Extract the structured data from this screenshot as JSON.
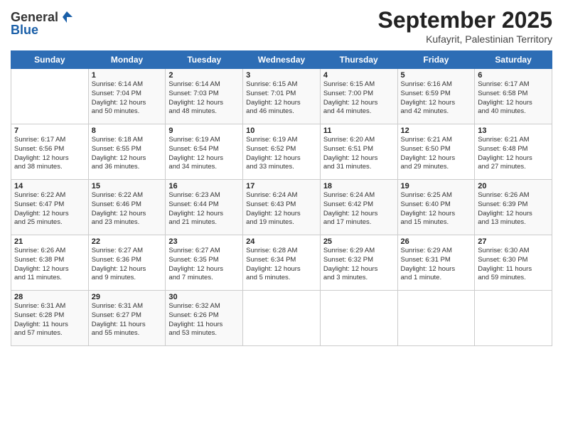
{
  "header": {
    "logo_line1": "General",
    "logo_line2": "Blue",
    "main_title": "September 2025",
    "subtitle": "Kufayrit, Palestinian Territory"
  },
  "calendar": {
    "days_of_week": [
      "Sunday",
      "Monday",
      "Tuesday",
      "Wednesday",
      "Thursday",
      "Friday",
      "Saturday"
    ],
    "weeks": [
      [
        {
          "num": "",
          "info": ""
        },
        {
          "num": "1",
          "info": "Sunrise: 6:14 AM\nSunset: 7:04 PM\nDaylight: 12 hours\nand 50 minutes."
        },
        {
          "num": "2",
          "info": "Sunrise: 6:14 AM\nSunset: 7:03 PM\nDaylight: 12 hours\nand 48 minutes."
        },
        {
          "num": "3",
          "info": "Sunrise: 6:15 AM\nSunset: 7:01 PM\nDaylight: 12 hours\nand 46 minutes."
        },
        {
          "num": "4",
          "info": "Sunrise: 6:15 AM\nSunset: 7:00 PM\nDaylight: 12 hours\nand 44 minutes."
        },
        {
          "num": "5",
          "info": "Sunrise: 6:16 AM\nSunset: 6:59 PM\nDaylight: 12 hours\nand 42 minutes."
        },
        {
          "num": "6",
          "info": "Sunrise: 6:17 AM\nSunset: 6:58 PM\nDaylight: 12 hours\nand 40 minutes."
        }
      ],
      [
        {
          "num": "7",
          "info": "Sunrise: 6:17 AM\nSunset: 6:56 PM\nDaylight: 12 hours\nand 38 minutes."
        },
        {
          "num": "8",
          "info": "Sunrise: 6:18 AM\nSunset: 6:55 PM\nDaylight: 12 hours\nand 36 minutes."
        },
        {
          "num": "9",
          "info": "Sunrise: 6:19 AM\nSunset: 6:54 PM\nDaylight: 12 hours\nand 34 minutes."
        },
        {
          "num": "10",
          "info": "Sunrise: 6:19 AM\nSunset: 6:52 PM\nDaylight: 12 hours\nand 33 minutes."
        },
        {
          "num": "11",
          "info": "Sunrise: 6:20 AM\nSunset: 6:51 PM\nDaylight: 12 hours\nand 31 minutes."
        },
        {
          "num": "12",
          "info": "Sunrise: 6:21 AM\nSunset: 6:50 PM\nDaylight: 12 hours\nand 29 minutes."
        },
        {
          "num": "13",
          "info": "Sunrise: 6:21 AM\nSunset: 6:48 PM\nDaylight: 12 hours\nand 27 minutes."
        }
      ],
      [
        {
          "num": "14",
          "info": "Sunrise: 6:22 AM\nSunset: 6:47 PM\nDaylight: 12 hours\nand 25 minutes."
        },
        {
          "num": "15",
          "info": "Sunrise: 6:22 AM\nSunset: 6:46 PM\nDaylight: 12 hours\nand 23 minutes."
        },
        {
          "num": "16",
          "info": "Sunrise: 6:23 AM\nSunset: 6:44 PM\nDaylight: 12 hours\nand 21 minutes."
        },
        {
          "num": "17",
          "info": "Sunrise: 6:24 AM\nSunset: 6:43 PM\nDaylight: 12 hours\nand 19 minutes."
        },
        {
          "num": "18",
          "info": "Sunrise: 6:24 AM\nSunset: 6:42 PM\nDaylight: 12 hours\nand 17 minutes."
        },
        {
          "num": "19",
          "info": "Sunrise: 6:25 AM\nSunset: 6:40 PM\nDaylight: 12 hours\nand 15 minutes."
        },
        {
          "num": "20",
          "info": "Sunrise: 6:26 AM\nSunset: 6:39 PM\nDaylight: 12 hours\nand 13 minutes."
        }
      ],
      [
        {
          "num": "21",
          "info": "Sunrise: 6:26 AM\nSunset: 6:38 PM\nDaylight: 12 hours\nand 11 minutes."
        },
        {
          "num": "22",
          "info": "Sunrise: 6:27 AM\nSunset: 6:36 PM\nDaylight: 12 hours\nand 9 minutes."
        },
        {
          "num": "23",
          "info": "Sunrise: 6:27 AM\nSunset: 6:35 PM\nDaylight: 12 hours\nand 7 minutes."
        },
        {
          "num": "24",
          "info": "Sunrise: 6:28 AM\nSunset: 6:34 PM\nDaylight: 12 hours\nand 5 minutes."
        },
        {
          "num": "25",
          "info": "Sunrise: 6:29 AM\nSunset: 6:32 PM\nDaylight: 12 hours\nand 3 minutes."
        },
        {
          "num": "26",
          "info": "Sunrise: 6:29 AM\nSunset: 6:31 PM\nDaylight: 12 hours\nand 1 minute."
        },
        {
          "num": "27",
          "info": "Sunrise: 6:30 AM\nSunset: 6:30 PM\nDaylight: 11 hours\nand 59 minutes."
        }
      ],
      [
        {
          "num": "28",
          "info": "Sunrise: 6:31 AM\nSunset: 6:28 PM\nDaylight: 11 hours\nand 57 minutes."
        },
        {
          "num": "29",
          "info": "Sunrise: 6:31 AM\nSunset: 6:27 PM\nDaylight: 11 hours\nand 55 minutes."
        },
        {
          "num": "30",
          "info": "Sunrise: 6:32 AM\nSunset: 6:26 PM\nDaylight: 11 hours\nand 53 minutes."
        },
        {
          "num": "",
          "info": ""
        },
        {
          "num": "",
          "info": ""
        },
        {
          "num": "",
          "info": ""
        },
        {
          "num": "",
          "info": ""
        }
      ]
    ]
  }
}
